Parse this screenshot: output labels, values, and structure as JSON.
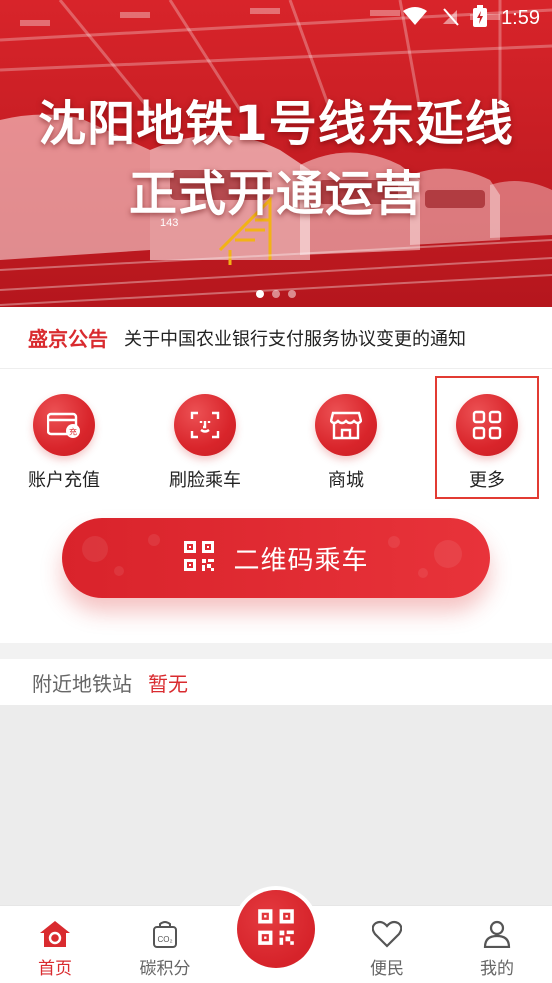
{
  "status": {
    "time": "1:59"
  },
  "banner": {
    "line1": "沈阳地铁1号线东延线",
    "line2": "正式开通运营",
    "train_number": "143",
    "dots": 3,
    "active_dot": 1
  },
  "notice": {
    "label": "盛京公告",
    "text": "关于中国农业银行支付服务协议变更的通知"
  },
  "quick": {
    "items": [
      {
        "label": "账户充值",
        "icon": "card-recharge-icon"
      },
      {
        "label": "刷脸乘车",
        "icon": "face-scan-icon"
      },
      {
        "label": "商城",
        "icon": "shop-icon"
      },
      {
        "label": "更多",
        "icon": "grid-more-icon"
      }
    ]
  },
  "qr_ride": {
    "label": "二维码乘车",
    "icon": "qr-code-icon"
  },
  "nearby": {
    "label": "附近地铁站",
    "value": "暂无"
  },
  "tabs": {
    "items": [
      {
        "label": "首页",
        "icon": "home-icon",
        "active": true
      },
      {
        "label": "碳积分",
        "icon": "co2-bag-icon",
        "active": false
      },
      {
        "label": "便民",
        "icon": "heart-icon",
        "active": false
      },
      {
        "label": "我的",
        "icon": "person-icon",
        "active": false
      }
    ],
    "center_icon": "qr-code-icon"
  },
  "colors": {
    "brand_red": "#d92b2f",
    "tab_inactive": "#666666",
    "map_bg": "#ececec"
  }
}
